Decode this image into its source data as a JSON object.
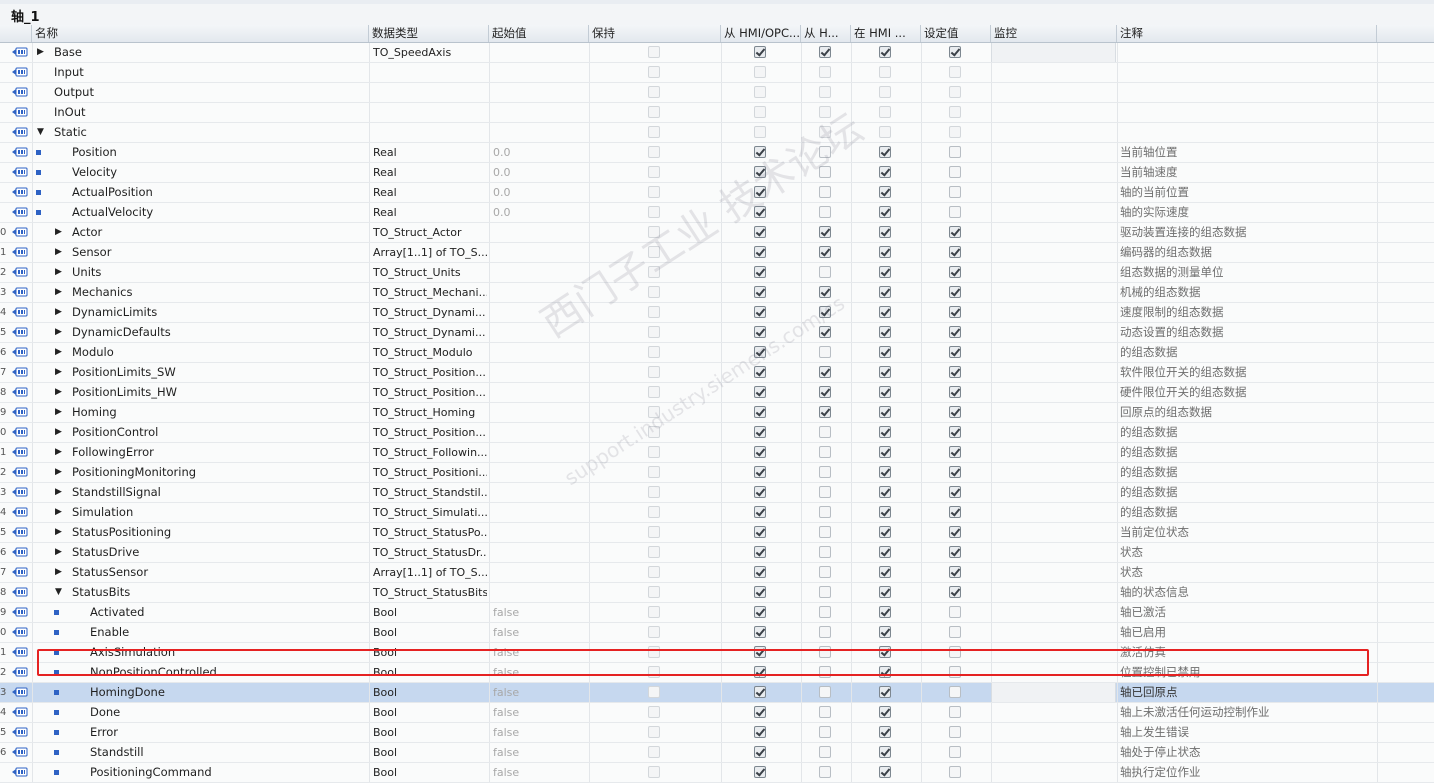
{
  "window": {
    "title": "轴_1"
  },
  "columns": {
    "name": "名称",
    "data_type": "数据类型",
    "start_value": "起始值",
    "retain": "保持",
    "hmi_access": "从 HMI/OPC...",
    "hmi_write": "从 H...",
    "hmi_visible": "在 HMI ...",
    "setpoint": "设定值",
    "monitor": "监控",
    "comment": "注释"
  },
  "watermark": {
    "line1": "西门子工业 技术论坛",
    "line2": "support.industry.siemens.com/cs"
  },
  "rows": [
    {
      "num": "",
      "level": 1,
      "expander": "collapsed",
      "name": "Base",
      "dtype": "TO_SpeedAxis",
      "start": "",
      "c": [
        0,
        1,
        1,
        1,
        1
      ],
      "dis": [
        1,
        0,
        0,
        0,
        0
      ],
      "comment": "",
      "monitor_box": true
    },
    {
      "num": "",
      "level": 1,
      "expander": "none",
      "name": "Input",
      "dtype": "",
      "start": "",
      "c": [
        0,
        0,
        0,
        0,
        0
      ],
      "dis": [
        1,
        1,
        1,
        1,
        1
      ],
      "comment": ""
    },
    {
      "num": "",
      "level": 1,
      "expander": "none",
      "name": "Output",
      "dtype": "",
      "start": "",
      "c": [
        0,
        0,
        0,
        0,
        0
      ],
      "dis": [
        1,
        1,
        1,
        1,
        1
      ],
      "comment": ""
    },
    {
      "num": "",
      "level": 1,
      "expander": "none",
      "name": "InOut",
      "dtype": "",
      "start": "",
      "c": [
        0,
        0,
        0,
        0,
        0
      ],
      "dis": [
        1,
        1,
        1,
        1,
        1
      ],
      "comment": ""
    },
    {
      "num": "",
      "level": 1,
      "expander": "expanded",
      "name": "Static",
      "dtype": "",
      "start": "",
      "c": [
        0,
        0,
        0,
        0,
        0
      ],
      "dis": [
        1,
        1,
        1,
        1,
        1
      ],
      "comment": ""
    },
    {
      "num": "",
      "level": 2,
      "expander": "bullet",
      "name": "Position",
      "dtype": "Real",
      "start": "0.0",
      "c": [
        0,
        1,
        0,
        1,
        0
      ],
      "dis": [
        1,
        0,
        0,
        0,
        0
      ],
      "comment": "当前轴位置"
    },
    {
      "num": "",
      "level": 2,
      "expander": "bullet",
      "name": "Velocity",
      "dtype": "Real",
      "start": "0.0",
      "c": [
        0,
        1,
        0,
        1,
        0
      ],
      "dis": [
        1,
        0,
        0,
        0,
        0
      ],
      "comment": "当前轴速度"
    },
    {
      "num": "",
      "level": 2,
      "expander": "bullet",
      "name": "ActualPosition",
      "dtype": "Real",
      "start": "0.0",
      "c": [
        0,
        1,
        0,
        1,
        0
      ],
      "dis": [
        1,
        0,
        0,
        0,
        0
      ],
      "comment": "轴的当前位置"
    },
    {
      "num": "",
      "level": 2,
      "expander": "bullet",
      "name": "ActualVelocity",
      "dtype": "Real",
      "start": "0.0",
      "c": [
        0,
        1,
        0,
        1,
        0
      ],
      "dis": [
        1,
        0,
        0,
        0,
        0
      ],
      "comment": "轴的实际速度"
    },
    {
      "num": "0",
      "level": 2,
      "expander": "collapsed",
      "name": "Actor",
      "dtype": "TO_Struct_Actor",
      "start": "",
      "c": [
        0,
        1,
        1,
        1,
        1
      ],
      "dis": [
        1,
        0,
        0,
        0,
        0
      ],
      "comment": "驱动装置连接的组态数据"
    },
    {
      "num": "1",
      "level": 2,
      "expander": "collapsed",
      "name": "Sensor",
      "dtype": "Array[1..1] of TO_S...",
      "start": "",
      "c": [
        0,
        1,
        1,
        1,
        1
      ],
      "dis": [
        1,
        0,
        0,
        0,
        0
      ],
      "comment": "编码器的组态数据"
    },
    {
      "num": "2",
      "level": 2,
      "expander": "collapsed",
      "name": "Units",
      "dtype": "TO_Struct_Units",
      "start": "",
      "c": [
        0,
        1,
        0,
        1,
        1
      ],
      "dis": [
        1,
        0,
        0,
        0,
        0
      ],
      "comment": "组态数据的测量单位"
    },
    {
      "num": "3",
      "level": 2,
      "expander": "collapsed",
      "name": "Mechanics",
      "dtype": "TO_Struct_Mechani...",
      "start": "",
      "c": [
        0,
        1,
        1,
        1,
        1
      ],
      "dis": [
        1,
        0,
        0,
        0,
        0
      ],
      "comment": "机械的组态数据"
    },
    {
      "num": "4",
      "level": 2,
      "expander": "collapsed",
      "name": "DynamicLimits",
      "dtype": "TO_Struct_Dynami...",
      "start": "",
      "c": [
        0,
        1,
        1,
        1,
        1
      ],
      "dis": [
        1,
        0,
        0,
        0,
        0
      ],
      "comment": "速度限制的组态数据"
    },
    {
      "num": "5",
      "level": 2,
      "expander": "collapsed",
      "name": "DynamicDefaults",
      "dtype": "TO_Struct_Dynami...",
      "start": "",
      "c": [
        0,
        1,
        1,
        1,
        1
      ],
      "dis": [
        1,
        0,
        0,
        0,
        0
      ],
      "comment": "动态设置的组态数据"
    },
    {
      "num": "6",
      "level": 2,
      "expander": "collapsed",
      "name": "Modulo",
      "dtype": "TO_Struct_Modulo",
      "start": "",
      "c": [
        0,
        1,
        0,
        1,
        1
      ],
      "dis": [
        1,
        0,
        0,
        0,
        0
      ],
      "comment": "的组态数据"
    },
    {
      "num": "7",
      "level": 2,
      "expander": "collapsed",
      "name": "PositionLimits_SW",
      "dtype": "TO_Struct_Position...",
      "start": "",
      "c": [
        0,
        1,
        1,
        1,
        1
      ],
      "dis": [
        1,
        0,
        0,
        0,
        0
      ],
      "comment": "软件限位开关的组态数据"
    },
    {
      "num": "8",
      "level": 2,
      "expander": "collapsed",
      "name": "PositionLimits_HW",
      "dtype": "TO_Struct_Position...",
      "start": "",
      "c": [
        0,
        1,
        1,
        1,
        1
      ],
      "dis": [
        1,
        0,
        0,
        0,
        0
      ],
      "comment": "硬件限位开关的组态数据"
    },
    {
      "num": "9",
      "level": 2,
      "expander": "collapsed",
      "name": "Homing",
      "dtype": "TO_Struct_Homing",
      "start": "",
      "c": [
        0,
        1,
        1,
        1,
        1
      ],
      "dis": [
        1,
        0,
        0,
        0,
        0
      ],
      "comment": "回原点的组态数据"
    },
    {
      "num": "0",
      "level": 2,
      "expander": "collapsed",
      "name": "PositionControl",
      "dtype": "TO_Struct_Position...",
      "start": "",
      "c": [
        0,
        1,
        0,
        1,
        1
      ],
      "dis": [
        1,
        0,
        0,
        0,
        0
      ],
      "comment": "的组态数据"
    },
    {
      "num": "1",
      "level": 2,
      "expander": "collapsed",
      "name": "FollowingError",
      "dtype": "TO_Struct_Followin...",
      "start": "",
      "c": [
        0,
        1,
        0,
        1,
        1
      ],
      "dis": [
        1,
        0,
        0,
        0,
        0
      ],
      "comment": "的组态数据"
    },
    {
      "num": "2",
      "level": 2,
      "expander": "collapsed",
      "name": "PositioningMonitoring",
      "dtype": "TO_Struct_Positioni...",
      "start": "",
      "c": [
        0,
        1,
        0,
        1,
        1
      ],
      "dis": [
        1,
        0,
        0,
        0,
        0
      ],
      "comment": "的组态数据"
    },
    {
      "num": "3",
      "level": 2,
      "expander": "collapsed",
      "name": "StandstillSignal",
      "dtype": "TO_Struct_Standstil...",
      "start": "",
      "c": [
        0,
        1,
        0,
        1,
        1
      ],
      "dis": [
        1,
        0,
        0,
        0,
        0
      ],
      "comment": "的组态数据"
    },
    {
      "num": "4",
      "level": 2,
      "expander": "collapsed",
      "name": "Simulation",
      "dtype": "TO_Struct_Simulati...",
      "start": "",
      "c": [
        0,
        1,
        0,
        1,
        1
      ],
      "dis": [
        1,
        0,
        0,
        0,
        0
      ],
      "comment": "的组态数据"
    },
    {
      "num": "5",
      "level": 2,
      "expander": "collapsed",
      "name": "StatusPositioning",
      "dtype": "TO_Struct_StatusPo...",
      "start": "",
      "c": [
        0,
        1,
        0,
        1,
        1
      ],
      "dis": [
        1,
        0,
        0,
        0,
        0
      ],
      "comment": "当前定位状态"
    },
    {
      "num": "6",
      "level": 2,
      "expander": "collapsed",
      "name": "StatusDrive",
      "dtype": "TO_Struct_StatusDr...",
      "start": "",
      "c": [
        0,
        1,
        0,
        1,
        1
      ],
      "dis": [
        1,
        0,
        0,
        0,
        0
      ],
      "comment": "状态"
    },
    {
      "num": "7",
      "level": 2,
      "expander": "collapsed",
      "name": "StatusSensor",
      "dtype": "Array[1..1] of TO_S...",
      "start": "",
      "c": [
        0,
        1,
        0,
        1,
        1
      ],
      "dis": [
        1,
        0,
        0,
        0,
        0
      ],
      "comment": "状态"
    },
    {
      "num": "8",
      "level": 2,
      "expander": "expanded",
      "name": "StatusBits",
      "dtype": "TO_Struct_StatusBits",
      "start": "",
      "c": [
        0,
        1,
        0,
        1,
        1
      ],
      "dis": [
        1,
        0,
        0,
        0,
        0
      ],
      "comment": "轴的状态信息"
    },
    {
      "num": "9",
      "level": 3,
      "expander": "bullet",
      "name": "Activated",
      "dtype": "Bool",
      "start": "false",
      "c": [
        0,
        1,
        0,
        1,
        0
      ],
      "dis": [
        1,
        0,
        0,
        0,
        0
      ],
      "comment": "轴已激活"
    },
    {
      "num": "0",
      "level": 3,
      "expander": "bullet",
      "name": "Enable",
      "dtype": "Bool",
      "start": "false",
      "c": [
        0,
        1,
        0,
        1,
        0
      ],
      "dis": [
        1,
        0,
        0,
        0,
        0
      ],
      "comment": "轴已启用"
    },
    {
      "num": "1",
      "level": 3,
      "expander": "bullet",
      "name": "AxisSimulation",
      "dtype": "Bool",
      "start": "false",
      "c": [
        0,
        1,
        0,
        1,
        0
      ],
      "dis": [
        1,
        0,
        0,
        0,
        0
      ],
      "comment": "激活仿真"
    },
    {
      "num": "2",
      "level": 3,
      "expander": "bullet",
      "name": "NonPositionControlled",
      "dtype": "Bool",
      "start": "false",
      "c": [
        0,
        1,
        0,
        1,
        0
      ],
      "dis": [
        1,
        0,
        0,
        0,
        0
      ],
      "comment": "位置控制已禁用"
    },
    {
      "num": "3",
      "level": 3,
      "expander": "bullet",
      "name": "HomingDone",
      "dtype": "Bool",
      "start": "false",
      "c": [
        0,
        1,
        0,
        1,
        0
      ],
      "dis": [
        1,
        0,
        0,
        0,
        0
      ],
      "comment": "轴已回原点",
      "selected": true,
      "monitor_box": true
    },
    {
      "num": "4",
      "level": 3,
      "expander": "bullet",
      "name": "Done",
      "dtype": "Bool",
      "start": "false",
      "c": [
        0,
        1,
        0,
        1,
        0
      ],
      "dis": [
        1,
        0,
        0,
        0,
        0
      ],
      "comment": "轴上未激活任何运动控制作业"
    },
    {
      "num": "5",
      "level": 3,
      "expander": "bullet",
      "name": "Error",
      "dtype": "Bool",
      "start": "false",
      "c": [
        0,
        1,
        0,
        1,
        0
      ],
      "dis": [
        1,
        0,
        0,
        0,
        0
      ],
      "comment": "轴上发生错误"
    },
    {
      "num": "6",
      "level": 3,
      "expander": "bullet",
      "name": "Standstill",
      "dtype": "Bool",
      "start": "false",
      "c": [
        0,
        1,
        0,
        1,
        0
      ],
      "dis": [
        1,
        0,
        0,
        0,
        0
      ],
      "comment": "轴处于停止状态"
    },
    {
      "num": "",
      "level": 3,
      "expander": "bullet",
      "name": "PositioningCommand",
      "dtype": "Bool",
      "start": "false",
      "c": [
        0,
        1,
        0,
        1,
        0
      ],
      "dis": [
        1,
        0,
        0,
        0,
        0
      ],
      "comment": "轴执行定位作业"
    }
  ],
  "colors": {
    "selection": "#c6d8ef",
    "highlight_border": "#e52222",
    "bullet": "#2e62c4"
  }
}
